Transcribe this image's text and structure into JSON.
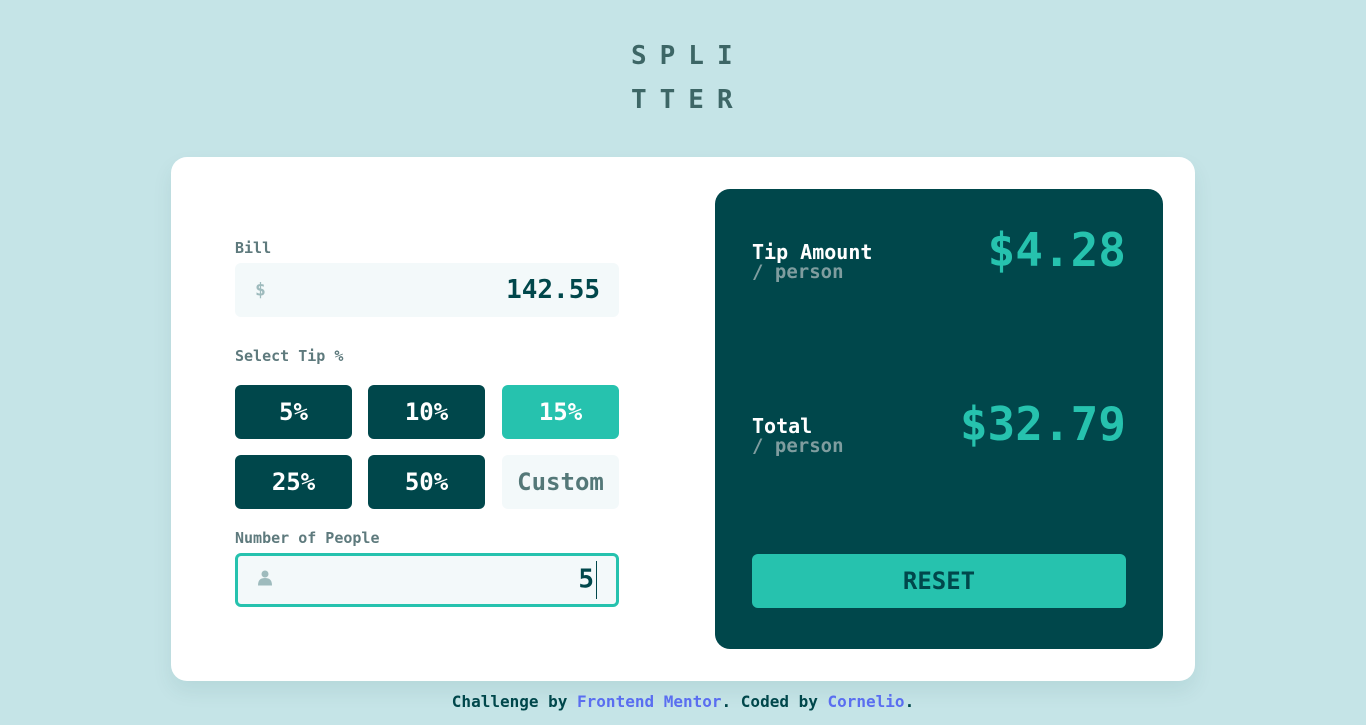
{
  "logo": {
    "line1": "SPLI",
    "line2": "TTER"
  },
  "bill": {
    "label": "Bill",
    "icon": "dollar-icon",
    "icon_glyph": "$",
    "value": "142.55"
  },
  "tip": {
    "label": "Select Tip %",
    "options": [
      "5%",
      "10%",
      "15%",
      "25%",
      "50%"
    ],
    "selected": "15%",
    "custom_placeholder": "Custom"
  },
  "people": {
    "label": "Number of People",
    "icon": "person-icon",
    "value": "5"
  },
  "results": {
    "tip_label": "Tip Amount",
    "tip_sub": "/ person",
    "tip_value": "$4.28",
    "total_label": "Total",
    "total_sub": "/ person",
    "total_value": "$32.79",
    "reset_label": "RESET"
  },
  "footer": {
    "prefix": "Challenge by ",
    "link1": "Frontend Mentor",
    "middle": ". Coded by ",
    "link2": "Cornelio",
    "suffix": "."
  },
  "colors": {
    "background": "#c5e4e7",
    "dark": "#00474b",
    "accent": "#26c2ae",
    "link": "#5a6ef0"
  }
}
